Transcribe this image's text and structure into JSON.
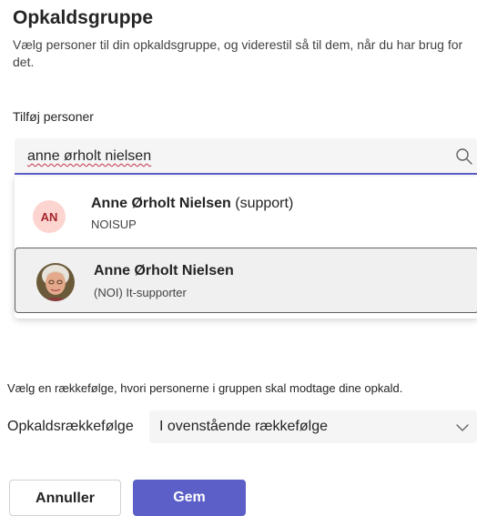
{
  "header": {
    "title": "Opkaldsgruppe",
    "subtitle": "Vælg personer til din opkaldsgruppe, og viderestil så til dem, når du har brug for det."
  },
  "add_people": {
    "label": "Tilføj personer",
    "search_value": "anne ørholt nielsen",
    "search_icon": "search-icon"
  },
  "results": [
    {
      "initials": "AN",
      "name": "Anne Ørholt Nielsen",
      "suffix": " (support)",
      "subtitle": "NOISUP",
      "avatar_bg": "#fcd5d1",
      "avatar_fg": "#a4262c"
    },
    {
      "name": "Anne Ørholt Nielsen",
      "suffix": "",
      "subtitle": "(NOI) It-supporter",
      "selected": true
    }
  ],
  "order": {
    "description": "Vælg en rækkefølge, hvori personerne i gruppen skal modtage dine opkald.",
    "label": "Opkaldsrækkefølge",
    "selected": "I ovenstående rækkefølge"
  },
  "buttons": {
    "cancel": "Annuller",
    "save": "Gem"
  },
  "colors": {
    "accent": "#5b5fc7",
    "field_bg": "#f5f5f5"
  }
}
